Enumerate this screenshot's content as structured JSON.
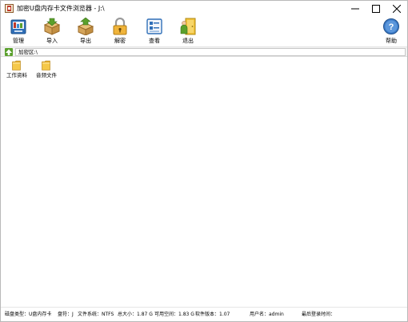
{
  "window": {
    "title": "加密U盘内存卡文件浏览器 - J:\\"
  },
  "toolbar": {
    "items": [
      {
        "label": "管理",
        "icon": "manage-icon"
      },
      {
        "label": "导入",
        "icon": "import-box-icon"
      },
      {
        "label": "导出",
        "icon": "export-box-icon"
      },
      {
        "label": "解密",
        "icon": "padlock-icon"
      },
      {
        "label": "查看",
        "icon": "view-list-icon"
      },
      {
        "label": "退出",
        "icon": "exit-door-icon"
      }
    ],
    "help": {
      "label": "帮助",
      "icon": "help-icon"
    }
  },
  "address": {
    "path": "加密区:\\"
  },
  "files": [
    {
      "name": "工作资料",
      "icon": "folder-icon"
    },
    {
      "name": "音频文件",
      "icon": "folder-icon"
    }
  ],
  "status": {
    "disk_type": "磁盘类型：U盘内存卡",
    "drive": "盘符：J",
    "file_system": "文件系统：NTFS",
    "total_size": "总大小：1.87 G",
    "free_space": "可用空间：1.83 G",
    "version": "软件版本：1.07",
    "user": "用户名：admin",
    "last_login": "最后登录时间："
  },
  "colors": {
    "folder": "#f5c84a",
    "accent_blue": "#2f6fb8",
    "accent_green": "#5aa02c"
  }
}
